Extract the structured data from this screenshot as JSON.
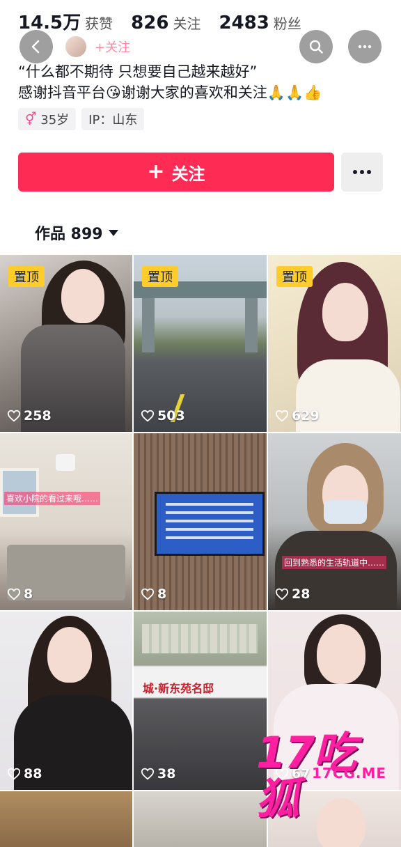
{
  "profile": {
    "stats": [
      {
        "value": "14.5万",
        "label": "获赞"
      },
      {
        "value": "826",
        "label": "关注"
      },
      {
        "value": "2483",
        "label": "粉丝"
      }
    ],
    "mini_follow": "+关注",
    "bio_line1": "“什么都不期待 只想要自己越来越好”",
    "bio_line2": "感谢抖音平台😘谢谢大家的喜欢和关注🙏🙏👍",
    "age_tag": "35岁",
    "ip_tag": "IP：山东",
    "gender_symbol": "⚥"
  },
  "actions": {
    "follow_label": "关注",
    "follow_plus": "+",
    "more_dots": "···"
  },
  "works": {
    "label": "作品 899"
  },
  "tiles": [
    {
      "likes": "258",
      "pinned": "置顶"
    },
    {
      "likes": "503",
      "pinned": "置顶"
    },
    {
      "likes": "629",
      "pinned": "置顶"
    },
    {
      "likes": "8",
      "caption": "喜欢小院的看过来哦……"
    },
    {
      "likes": "8"
    },
    {
      "likes": "28",
      "caption": "回到熟悉的生活轨道中……"
    },
    {
      "likes": "88"
    },
    {
      "likes": "38",
      "caption": "城·新东苑名邸"
    },
    {
      "likes": "67"
    }
  ],
  "watermark": {
    "big": "17吃狐",
    "small": "17CG.ME"
  },
  "colors": {
    "follow_red": "#fe2c55",
    "pin_yellow": "#ffcc29",
    "watermark_pink": "#ff1fa0"
  },
  "icons": [
    "back-icon",
    "search-icon",
    "more-icon",
    "heart-icon",
    "gender-icon",
    "caret-down-icon"
  ]
}
